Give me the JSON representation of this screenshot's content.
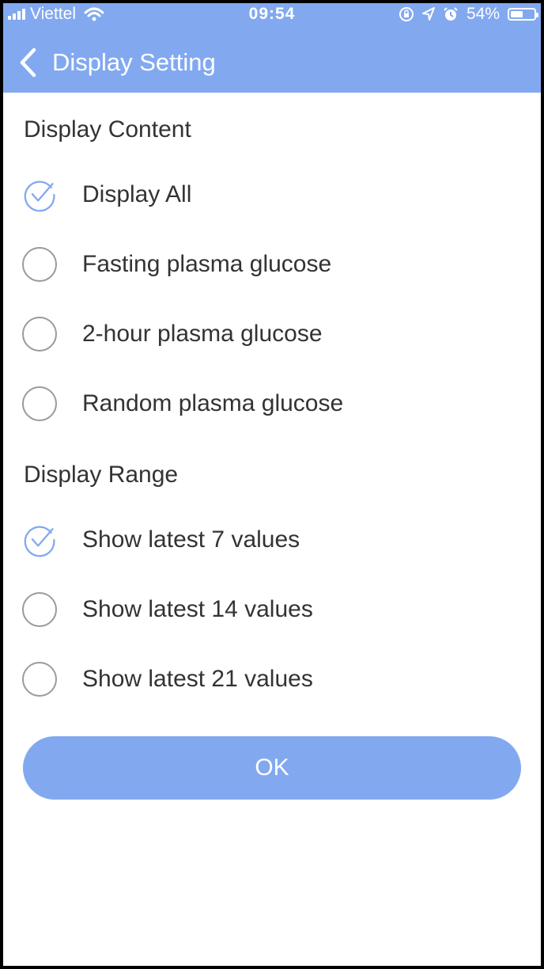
{
  "status_bar": {
    "carrier": "Viettel",
    "time": "09:54",
    "battery": "54%",
    "battery_level": 0.54
  },
  "header": {
    "title": "Display Setting"
  },
  "display_content": {
    "title": "Display Content",
    "options": [
      {
        "label": "Display All",
        "selected": true
      },
      {
        "label": "Fasting plasma glucose",
        "selected": false
      },
      {
        "label": "2-hour plasma glucose",
        "selected": false
      },
      {
        "label": "Random plasma glucose",
        "selected": false
      }
    ]
  },
  "display_range": {
    "title": "Display Range",
    "options": [
      {
        "label": "Show latest 7 values",
        "selected": true
      },
      {
        "label": "Show latest 14 values",
        "selected": false
      },
      {
        "label": "Show latest 21 values",
        "selected": false
      }
    ]
  },
  "ok_button": {
    "label": "OK"
  },
  "colors": {
    "accent": "#82a9f0",
    "text": "#333333",
    "radio_off": "#9a9a9a"
  }
}
